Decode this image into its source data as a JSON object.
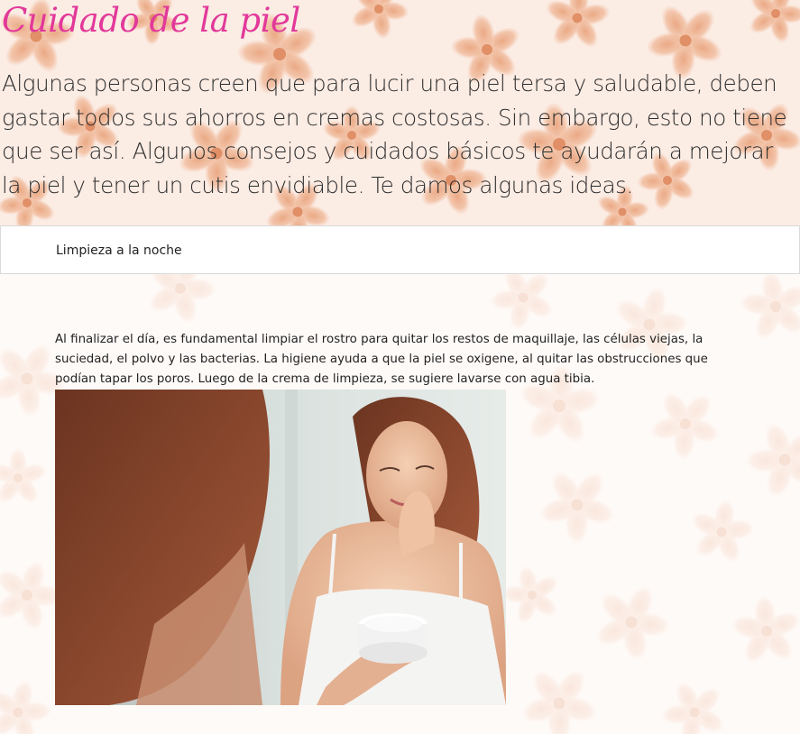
{
  "page": {
    "title": "Cuidado de la piel",
    "intro": "Algunas personas creen que para lucir una piel tersa y saludable, deben gastar todos sus ahorros en cremas costosas. Sin embargo, esto no tiene que ser así. Algunos consejos y cuidados básicos te ayudarán a mejorar la piel y tener un cutis envidiable. Te damos algunas ideas."
  },
  "accordion": {
    "item_title": "Limpieza a la noche",
    "item_text": "Al finalizar el día, es fundamental limpiar el rostro para quitar los restos de maquillaje, las células viejas, la suciedad, el polvo y las bacterias. La higiene ayuda a que la piel se oxigene, al quitar las obstrucciones que podían tapar los poros. Luego de la crema de limpieza, se sugiere lavarse con agua tibia.",
    "image_subject": "woman-applying-face-cream-photo"
  },
  "colors": {
    "title_pink": "#e2389a",
    "background": "#fbece4",
    "flower": "#f0b898"
  }
}
